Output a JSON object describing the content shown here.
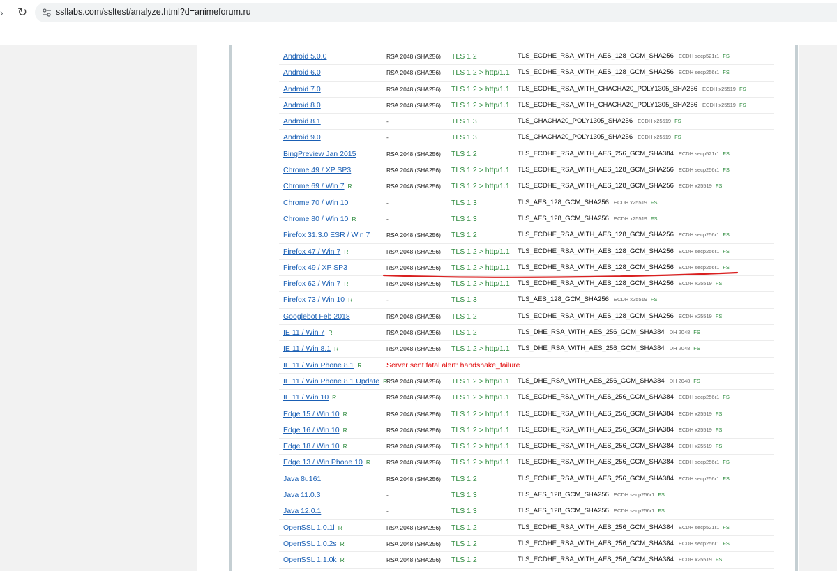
{
  "browser": {
    "url": "ssllabs.com/ssltest/analyze.html?d=animeforum.ru"
  },
  "colors": {
    "link": "#1a5fb4",
    "protocol_green": "#2e8b3e",
    "error_red": "#e00000",
    "annotation_red": "#d92020"
  },
  "simulations": [
    {
      "client": "Android 5.0.0",
      "ref": "",
      "key": "RSA 2048 (SHA256)",
      "protocol": "TLS 1.2",
      "suite": "TLS_ECDHE_RSA_WITH_AES_128_GCM_SHA256",
      "kx": "ECDH secp521r1",
      "fs": "FS"
    },
    {
      "client": "Android 6.0",
      "ref": "",
      "key": "RSA 2048 (SHA256)",
      "protocol": "TLS 1.2 > http/1.1",
      "suite": "TLS_ECDHE_RSA_WITH_AES_128_GCM_SHA256",
      "kx": "ECDH secp256r1",
      "fs": "FS"
    },
    {
      "client": "Android 7.0",
      "ref": "",
      "key": "RSA 2048 (SHA256)",
      "protocol": "TLS 1.2 > http/1.1",
      "suite": "TLS_ECDHE_RSA_WITH_CHACHA20_POLY1305_SHA256",
      "kx": "ECDH x25519",
      "fs": "FS"
    },
    {
      "client": "Android 8.0",
      "ref": "",
      "key": "RSA 2048 (SHA256)",
      "protocol": "TLS 1.2 > http/1.1",
      "suite": "TLS_ECDHE_RSA_WITH_CHACHA20_POLY1305_SHA256",
      "kx": "ECDH x25519",
      "fs": "FS"
    },
    {
      "client": "Android 8.1",
      "ref": "",
      "key": "-",
      "protocol": "TLS 1.3",
      "suite": "TLS_CHACHA20_POLY1305_SHA256",
      "kx": "ECDH x25519",
      "fs": "FS"
    },
    {
      "client": "Android 9.0",
      "ref": "",
      "key": "-",
      "protocol": "TLS 1.3",
      "suite": "TLS_CHACHA20_POLY1305_SHA256",
      "kx": "ECDH x25519",
      "fs": "FS"
    },
    {
      "client": "BingPreview Jan 2015",
      "ref": "",
      "key": "RSA 2048 (SHA256)",
      "protocol": "TLS 1.2",
      "suite": "TLS_ECDHE_RSA_WITH_AES_256_GCM_SHA384",
      "kx": "ECDH secp521r1",
      "fs": "FS"
    },
    {
      "client": "Chrome 49 / XP SP3",
      "ref": "",
      "key": "RSA 2048 (SHA256)",
      "protocol": "TLS 1.2 > http/1.1",
      "suite": "TLS_ECDHE_RSA_WITH_AES_128_GCM_SHA256",
      "kx": "ECDH secp256r1",
      "fs": "FS"
    },
    {
      "client": "Chrome 69 / Win 7",
      "ref": "R",
      "key": "RSA 2048 (SHA256)",
      "protocol": "TLS 1.2 > http/1.1",
      "suite": "TLS_ECDHE_RSA_WITH_AES_128_GCM_SHA256",
      "kx": "ECDH x25519",
      "fs": "FS"
    },
    {
      "client": "Chrome 70 / Win 10",
      "ref": "",
      "key": "-",
      "protocol": "TLS 1.3",
      "suite": "TLS_AES_128_GCM_SHA256",
      "kx": "ECDH x25519",
      "fs": "FS"
    },
    {
      "client": "Chrome 80 / Win 10",
      "ref": "R",
      "key": "-",
      "protocol": "TLS 1.3",
      "suite": "TLS_AES_128_GCM_SHA256",
      "kx": "ECDH x25519",
      "fs": "FS"
    },
    {
      "client": "Firefox 31.3.0 ESR / Win 7",
      "ref": "",
      "key": "RSA 2048 (SHA256)",
      "protocol": "TLS 1.2",
      "suite": "TLS_ECDHE_RSA_WITH_AES_128_GCM_SHA256",
      "kx": "ECDH secp256r1",
      "fs": "FS"
    },
    {
      "client": "Firefox 47 / Win 7",
      "ref": "R",
      "key": "RSA 2048 (SHA256)",
      "protocol": "TLS 1.2 > http/1.1",
      "suite": "TLS_ECDHE_RSA_WITH_AES_128_GCM_SHA256",
      "kx": "ECDH secp256r1",
      "fs": "FS"
    },
    {
      "client": "Firefox 49 / XP SP3",
      "ref": "",
      "key": "RSA 2048 (SHA256)",
      "protocol": "TLS 1.2 > http/1.1",
      "suite": "TLS_ECDHE_RSA_WITH_AES_128_GCM_SHA256",
      "kx": "ECDH secp256r1",
      "fs": "FS"
    },
    {
      "client": "Firefox 62 / Win 7",
      "ref": "R",
      "key": "RSA 2048 (SHA256)",
      "protocol": "TLS 1.2 > http/1.1",
      "suite": "TLS_ECDHE_RSA_WITH_AES_128_GCM_SHA256",
      "kx": "ECDH x25519",
      "fs": "FS"
    },
    {
      "client": "Firefox 73 / Win 10",
      "ref": "R",
      "key": "-",
      "protocol": "TLS 1.3",
      "suite": "TLS_AES_128_GCM_SHA256",
      "kx": "ECDH x25519",
      "fs": "FS"
    },
    {
      "client": "Googlebot Feb 2018",
      "ref": "",
      "key": "RSA 2048 (SHA256)",
      "protocol": "TLS 1.2",
      "suite": "TLS_ECDHE_RSA_WITH_AES_128_GCM_SHA256",
      "kx": "ECDH x25519",
      "fs": "FS"
    },
    {
      "client": "IE 11 / Win 7",
      "ref": "R",
      "key": "RSA 2048 (SHA256)",
      "protocol": "TLS 1.2",
      "suite": "TLS_DHE_RSA_WITH_AES_256_GCM_SHA384",
      "kx": "DH 2048",
      "fs": "FS"
    },
    {
      "client": "IE 11 / Win 8.1",
      "ref": "R",
      "key": "RSA 2048 (SHA256)",
      "protocol": "TLS 1.2 > http/1.1",
      "suite": "TLS_DHE_RSA_WITH_AES_256_GCM_SHA384",
      "kx": "DH 2048",
      "fs": "FS"
    },
    {
      "client": "IE 11 / Win Phone 8.1",
      "ref": "R",
      "error": "Server sent fatal alert: handshake_failure"
    },
    {
      "client": "IE 11 / Win Phone 8.1 Update",
      "ref": "R",
      "key": "RSA 2048 (SHA256)",
      "protocol": "TLS 1.2 > http/1.1",
      "suite": "TLS_DHE_RSA_WITH_AES_256_GCM_SHA384",
      "kx": "DH 2048",
      "fs": "FS"
    },
    {
      "client": "IE 11 / Win 10",
      "ref": "R",
      "key": "RSA 2048 (SHA256)",
      "protocol": "TLS 1.2 > http/1.1",
      "suite": "TLS_ECDHE_RSA_WITH_AES_256_GCM_SHA384",
      "kx": "ECDH secp256r1",
      "fs": "FS"
    },
    {
      "client": "Edge 15 / Win 10",
      "ref": "R",
      "key": "RSA 2048 (SHA256)",
      "protocol": "TLS 1.2 > http/1.1",
      "suite": "TLS_ECDHE_RSA_WITH_AES_256_GCM_SHA384",
      "kx": "ECDH x25519",
      "fs": "FS"
    },
    {
      "client": "Edge 16 / Win 10",
      "ref": "R",
      "key": "RSA 2048 (SHA256)",
      "protocol": "TLS 1.2 > http/1.1",
      "suite": "TLS_ECDHE_RSA_WITH_AES_256_GCM_SHA384",
      "kx": "ECDH x25519",
      "fs": "FS"
    },
    {
      "client": "Edge 18 / Win 10",
      "ref": "R",
      "key": "RSA 2048 (SHA256)",
      "protocol": "TLS 1.2 > http/1.1",
      "suite": "TLS_ECDHE_RSA_WITH_AES_256_GCM_SHA384",
      "kx": "ECDH x25519",
      "fs": "FS"
    },
    {
      "client": "Edge 13 / Win Phone 10",
      "ref": "R",
      "key": "RSA 2048 (SHA256)",
      "protocol": "TLS 1.2 > http/1.1",
      "suite": "TLS_ECDHE_RSA_WITH_AES_256_GCM_SHA384",
      "kx": "ECDH secp256r1",
      "fs": "FS"
    },
    {
      "client": "Java 8u161",
      "ref": "",
      "key": "RSA 2048 (SHA256)",
      "protocol": "TLS 1.2",
      "suite": "TLS_ECDHE_RSA_WITH_AES_256_GCM_SHA384",
      "kx": "ECDH secp256r1",
      "fs": "FS"
    },
    {
      "client": "Java 11.0.3",
      "ref": "",
      "key": "-",
      "protocol": "TLS 1.3",
      "suite": "TLS_AES_128_GCM_SHA256",
      "kx": "ECDH secp256r1",
      "fs": "FS"
    },
    {
      "client": "Java 12.0.1",
      "ref": "",
      "key": "-",
      "protocol": "TLS 1.3",
      "suite": "TLS_AES_128_GCM_SHA256",
      "kx": "ECDH secp256r1",
      "fs": "FS"
    },
    {
      "client": "OpenSSL 1.0.1l",
      "ref": "R",
      "key": "RSA 2048 (SHA256)",
      "protocol": "TLS 1.2",
      "suite": "TLS_ECDHE_RSA_WITH_AES_256_GCM_SHA384",
      "kx": "ECDH secp521r1",
      "fs": "FS"
    },
    {
      "client": "OpenSSL 1.0.2s",
      "ref": "R",
      "key": "RSA 2048 (SHA256)",
      "protocol": "TLS 1.2",
      "suite": "TLS_ECDHE_RSA_WITH_AES_256_GCM_SHA384",
      "kx": "ECDH secp256r1",
      "fs": "FS"
    },
    {
      "client": "OpenSSL 1.1.0k",
      "ref": "R",
      "key": "RSA 2048 (SHA256)",
      "protocol": "TLS 1.2",
      "suite": "TLS_ECDHE_RSA_WITH_AES_256_GCM_SHA384",
      "kx": "ECDH x25519",
      "fs": "FS"
    }
  ]
}
